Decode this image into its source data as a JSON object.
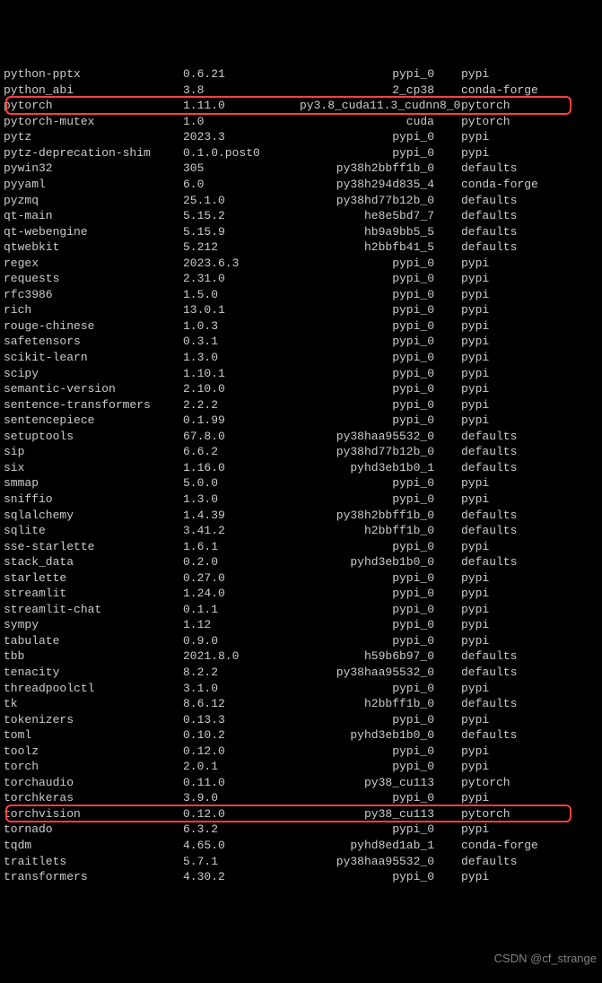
{
  "watermark": "CSDN @cf_strange",
  "highlighted_indices": [
    2,
    47
  ],
  "packages": [
    {
      "name": "python-pptx",
      "version": "0.6.21",
      "build": "pypi_0",
      "channel": "pypi"
    },
    {
      "name": "python_abi",
      "version": "3.8",
      "build": "2_cp38",
      "channel": "conda-forge"
    },
    {
      "name": "pytorch",
      "version": "1.11.0",
      "build": "py3.8_cuda11.3_cudnn8_0",
      "channel": "pytorch"
    },
    {
      "name": "pytorch-mutex",
      "version": "1.0",
      "build": "cuda",
      "channel": "pytorch"
    },
    {
      "name": "pytz",
      "version": "2023.3",
      "build": "pypi_0",
      "channel": "pypi"
    },
    {
      "name": "pytz-deprecation-shim",
      "version": "0.1.0.post0",
      "build": "pypi_0",
      "channel": "pypi"
    },
    {
      "name": "pywin32",
      "version": "305",
      "build": "py38h2bbff1b_0",
      "channel": "defaults"
    },
    {
      "name": "pyyaml",
      "version": "6.0",
      "build": "py38h294d835_4",
      "channel": "conda-forge"
    },
    {
      "name": "pyzmq",
      "version": "25.1.0",
      "build": "py38hd77b12b_0",
      "channel": "defaults"
    },
    {
      "name": "qt-main",
      "version": "5.15.2",
      "build": "he8e5bd7_7",
      "channel": "defaults"
    },
    {
      "name": "qt-webengine",
      "version": "5.15.9",
      "build": "hb9a9bb5_5",
      "channel": "defaults"
    },
    {
      "name": "qtwebkit",
      "version": "5.212",
      "build": "h2bbfb41_5",
      "channel": "defaults"
    },
    {
      "name": "regex",
      "version": "2023.6.3",
      "build": "pypi_0",
      "channel": "pypi"
    },
    {
      "name": "requests",
      "version": "2.31.0",
      "build": "pypi_0",
      "channel": "pypi"
    },
    {
      "name": "rfc3986",
      "version": "1.5.0",
      "build": "pypi_0",
      "channel": "pypi"
    },
    {
      "name": "rich",
      "version": "13.0.1",
      "build": "pypi_0",
      "channel": "pypi"
    },
    {
      "name": "rouge-chinese",
      "version": "1.0.3",
      "build": "pypi_0",
      "channel": "pypi"
    },
    {
      "name": "safetensors",
      "version": "0.3.1",
      "build": "pypi_0",
      "channel": "pypi"
    },
    {
      "name": "scikit-learn",
      "version": "1.3.0",
      "build": "pypi_0",
      "channel": "pypi"
    },
    {
      "name": "scipy",
      "version": "1.10.1",
      "build": "pypi_0",
      "channel": "pypi"
    },
    {
      "name": "semantic-version",
      "version": "2.10.0",
      "build": "pypi_0",
      "channel": "pypi"
    },
    {
      "name": "sentence-transformers",
      "version": "2.2.2",
      "build": "pypi_0",
      "channel": "pypi"
    },
    {
      "name": "sentencepiece",
      "version": "0.1.99",
      "build": "pypi_0",
      "channel": "pypi"
    },
    {
      "name": "setuptools",
      "version": "67.8.0",
      "build": "py38haa95532_0",
      "channel": "defaults"
    },
    {
      "name": "sip",
      "version": "6.6.2",
      "build": "py38hd77b12b_0",
      "channel": "defaults"
    },
    {
      "name": "six",
      "version": "1.16.0",
      "build": "pyhd3eb1b0_1",
      "channel": "defaults"
    },
    {
      "name": "smmap",
      "version": "5.0.0",
      "build": "pypi_0",
      "channel": "pypi"
    },
    {
      "name": "sniffio",
      "version": "1.3.0",
      "build": "pypi_0",
      "channel": "pypi"
    },
    {
      "name": "sqlalchemy",
      "version": "1.4.39",
      "build": "py38h2bbff1b_0",
      "channel": "defaults"
    },
    {
      "name": "sqlite",
      "version": "3.41.2",
      "build": "h2bbff1b_0",
      "channel": "defaults"
    },
    {
      "name": "sse-starlette",
      "version": "1.6.1",
      "build": "pypi_0",
      "channel": "pypi"
    },
    {
      "name": "stack_data",
      "version": "0.2.0",
      "build": "pyhd3eb1b0_0",
      "channel": "defaults"
    },
    {
      "name": "starlette",
      "version": "0.27.0",
      "build": "pypi_0",
      "channel": "pypi"
    },
    {
      "name": "streamlit",
      "version": "1.24.0",
      "build": "pypi_0",
      "channel": "pypi"
    },
    {
      "name": "streamlit-chat",
      "version": "0.1.1",
      "build": "pypi_0",
      "channel": "pypi"
    },
    {
      "name": "sympy",
      "version": "1.12",
      "build": "pypi_0",
      "channel": "pypi"
    },
    {
      "name": "tabulate",
      "version": "0.9.0",
      "build": "pypi_0",
      "channel": "pypi"
    },
    {
      "name": "tbb",
      "version": "2021.8.0",
      "build": "h59b6b97_0",
      "channel": "defaults"
    },
    {
      "name": "tenacity",
      "version": "8.2.2",
      "build": "py38haa95532_0",
      "channel": "defaults"
    },
    {
      "name": "threadpoolctl",
      "version": "3.1.0",
      "build": "pypi_0",
      "channel": "pypi"
    },
    {
      "name": "tk",
      "version": "8.6.12",
      "build": "h2bbff1b_0",
      "channel": "defaults"
    },
    {
      "name": "tokenizers",
      "version": "0.13.3",
      "build": "pypi_0",
      "channel": "pypi"
    },
    {
      "name": "toml",
      "version": "0.10.2",
      "build": "pyhd3eb1b0_0",
      "channel": "defaults"
    },
    {
      "name": "toolz",
      "version": "0.12.0",
      "build": "pypi_0",
      "channel": "pypi"
    },
    {
      "name": "torch",
      "version": "2.0.1",
      "build": "pypi_0",
      "channel": "pypi"
    },
    {
      "name": "torchaudio",
      "version": "0.11.0",
      "build": "py38_cu113",
      "channel": "pytorch"
    },
    {
      "name": "torchkeras",
      "version": "3.9.0",
      "build": "pypi_0",
      "channel": "pypi"
    },
    {
      "name": "torchvision",
      "version": "0.12.0",
      "build": "py38_cu113",
      "channel": "pytorch"
    },
    {
      "name": "tornado",
      "version": "6.3.2",
      "build": "pypi_0",
      "channel": "pypi"
    },
    {
      "name": "tqdm",
      "version": "4.65.0",
      "build": "pyhd8ed1ab_1",
      "channel": "conda-forge"
    },
    {
      "name": "traitlets",
      "version": "5.7.1",
      "build": "py38haa95532_0",
      "channel": "defaults"
    },
    {
      "name": "transformers",
      "version": "4.30.2",
      "build": "pypi_0",
      "channel": "pypi"
    }
  ]
}
